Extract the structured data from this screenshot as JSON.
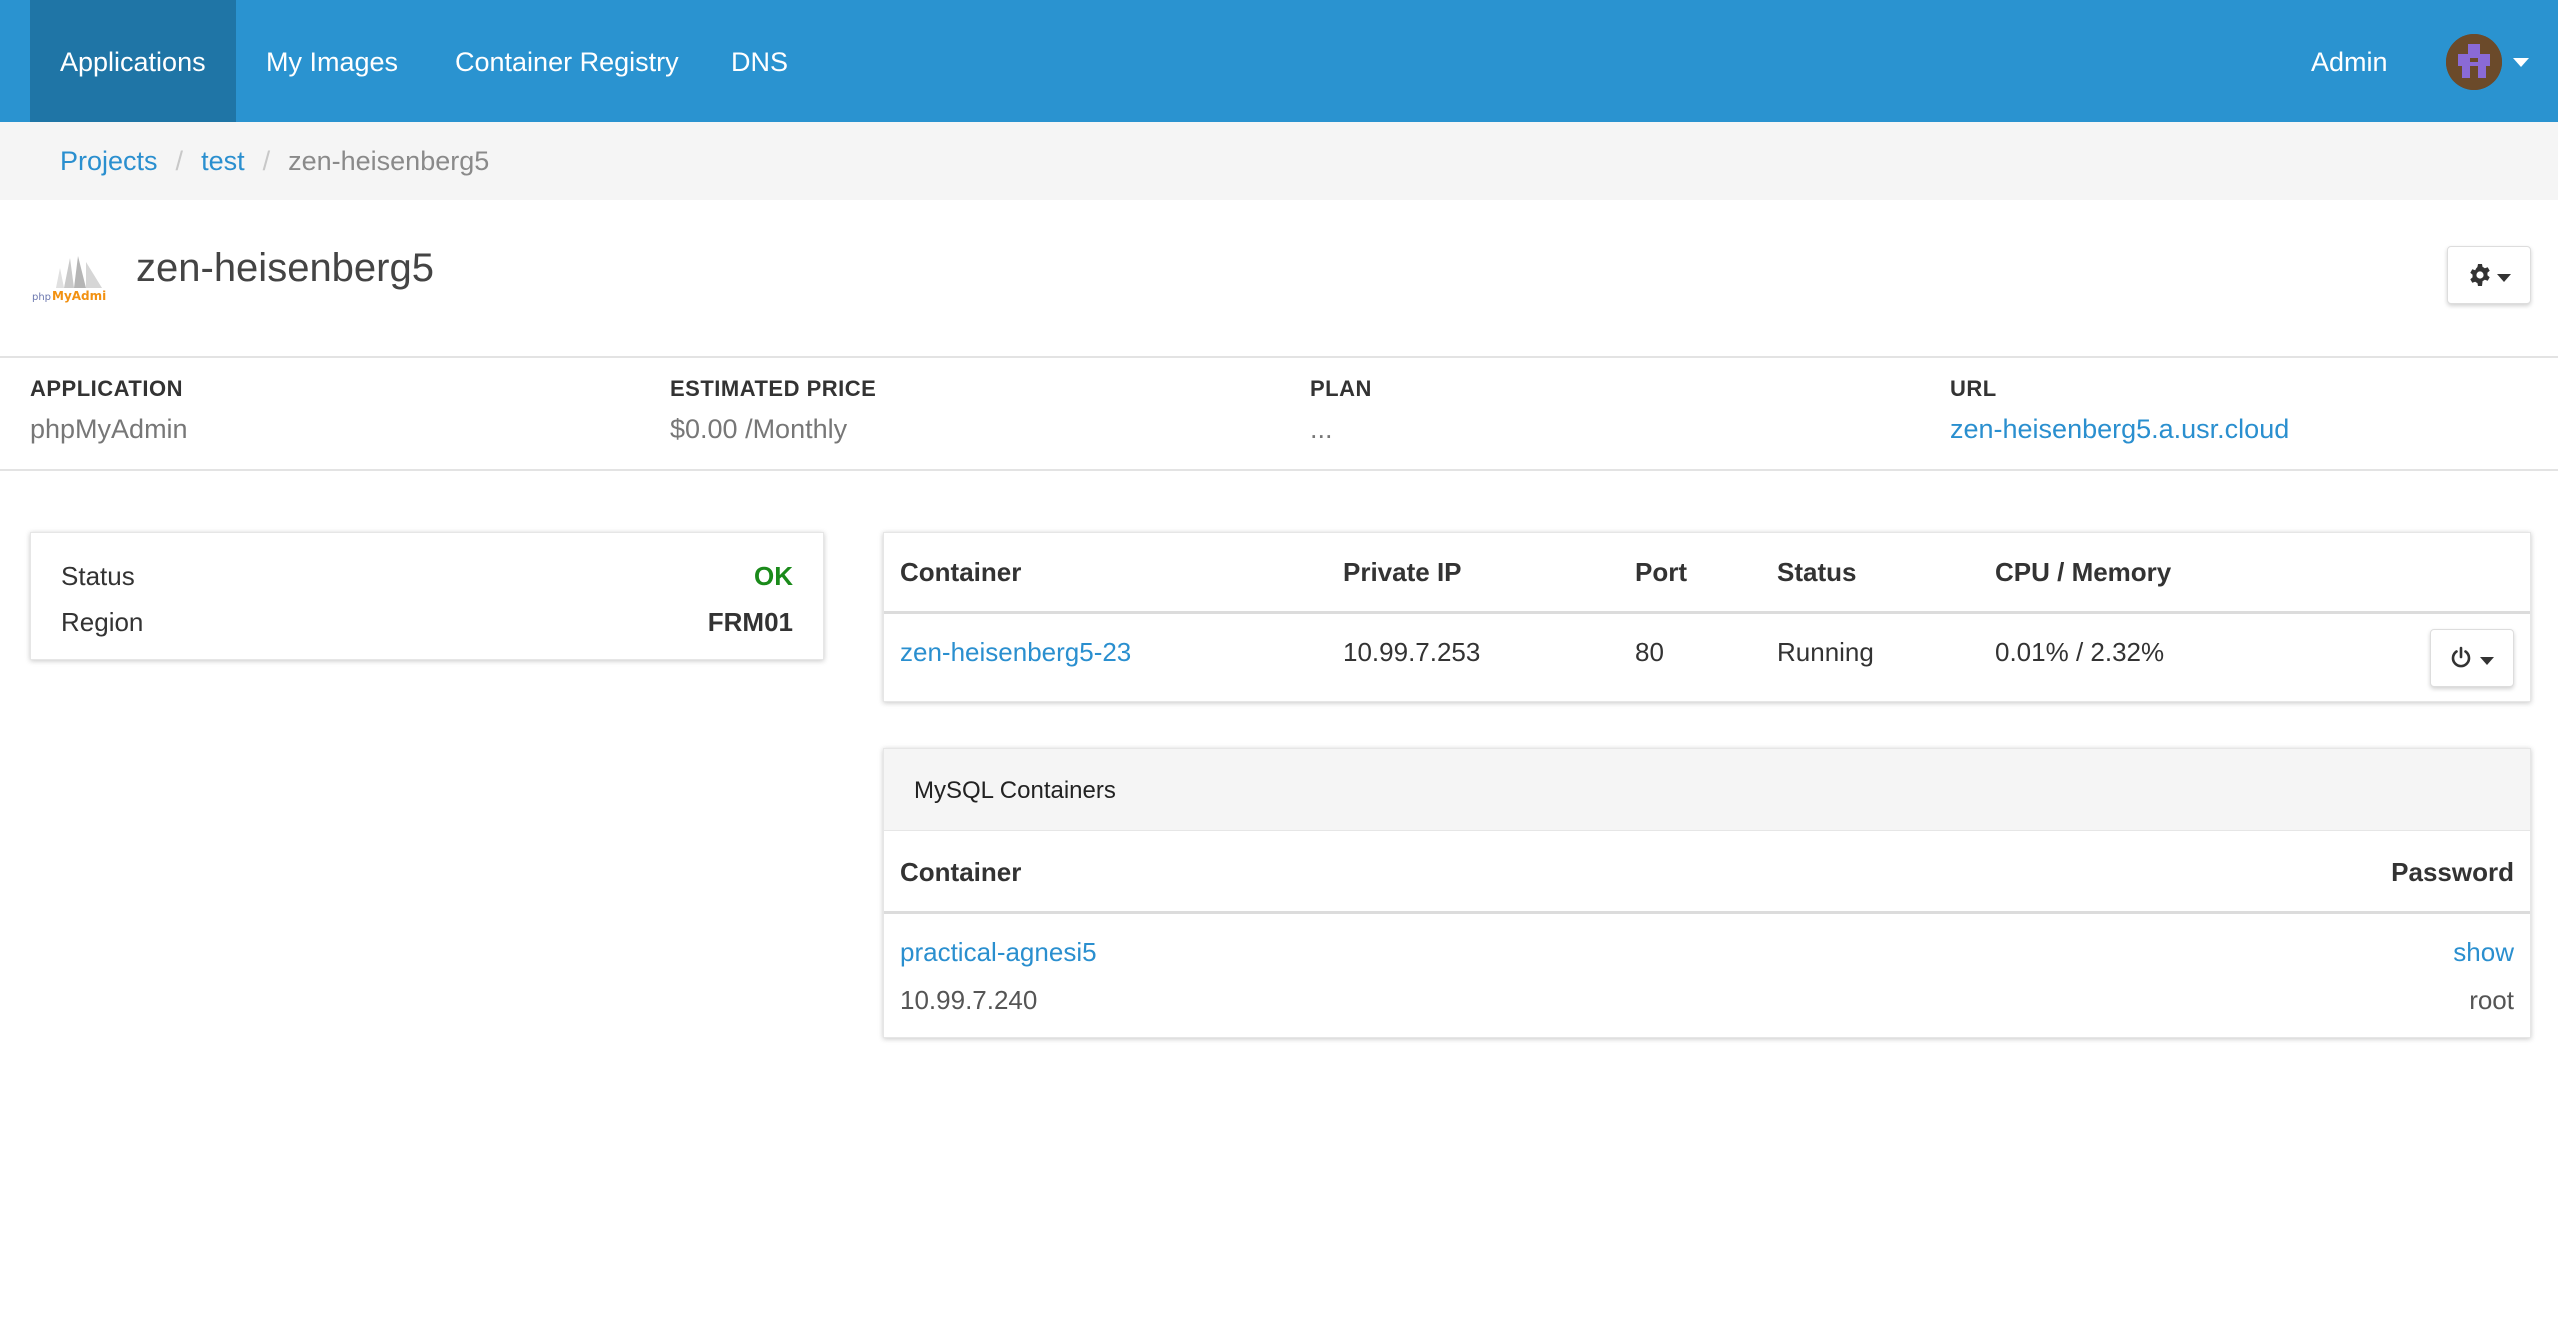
{
  "nav": {
    "items": [
      {
        "label": "Applications",
        "active": true
      },
      {
        "label": "My Images",
        "active": false
      },
      {
        "label": "Container Registry",
        "active": false
      },
      {
        "label": "DNS",
        "active": false
      }
    ],
    "user_label": "Admin",
    "avatar_icon": "pixel-avatar-icon"
  },
  "breadcrumb": {
    "items": [
      "Projects",
      "test"
    ],
    "current": "zen-heisenberg5"
  },
  "header": {
    "title": "zen-heisenberg5",
    "logo_icon": "phpmyadmin-logo",
    "settings_icon": "gear-icon"
  },
  "info": {
    "application_label": "APPLICATION",
    "application_value": "phpMyAdmin",
    "price_label": "ESTIMATED PRICE",
    "price_value": "$0.00 /Monthly",
    "plan_label": "PLAN",
    "plan_value": "...",
    "url_label": "URL",
    "url_value": "zen-heisenberg5.a.usr.cloud"
  },
  "status_card": {
    "status_label": "Status",
    "status_value": "OK",
    "region_label": "Region",
    "region_value": "FRM01"
  },
  "containers": {
    "headers": [
      "Container",
      "Private IP",
      "Port",
      "Status",
      "CPU / Memory"
    ],
    "rows": [
      {
        "container": "zen-heisenberg5-23",
        "private_ip": "10.99.7.253",
        "port": "80",
        "status": "Running",
        "cpu_memory": "0.01% / 2.32%"
      }
    ],
    "action_icon": "power-icon"
  },
  "mysql": {
    "title": "MySQL Containers",
    "headers": [
      "Container",
      "Password"
    ],
    "rows": [
      {
        "container": "practical-agnesi5",
        "ip": "10.99.7.240",
        "password_action": "show",
        "user": "root"
      }
    ]
  },
  "colors": {
    "nav_bg": "#2a93d0",
    "nav_active": "#1f75a6",
    "link": "#2a8fcf",
    "ok": "#1a8a1a"
  }
}
